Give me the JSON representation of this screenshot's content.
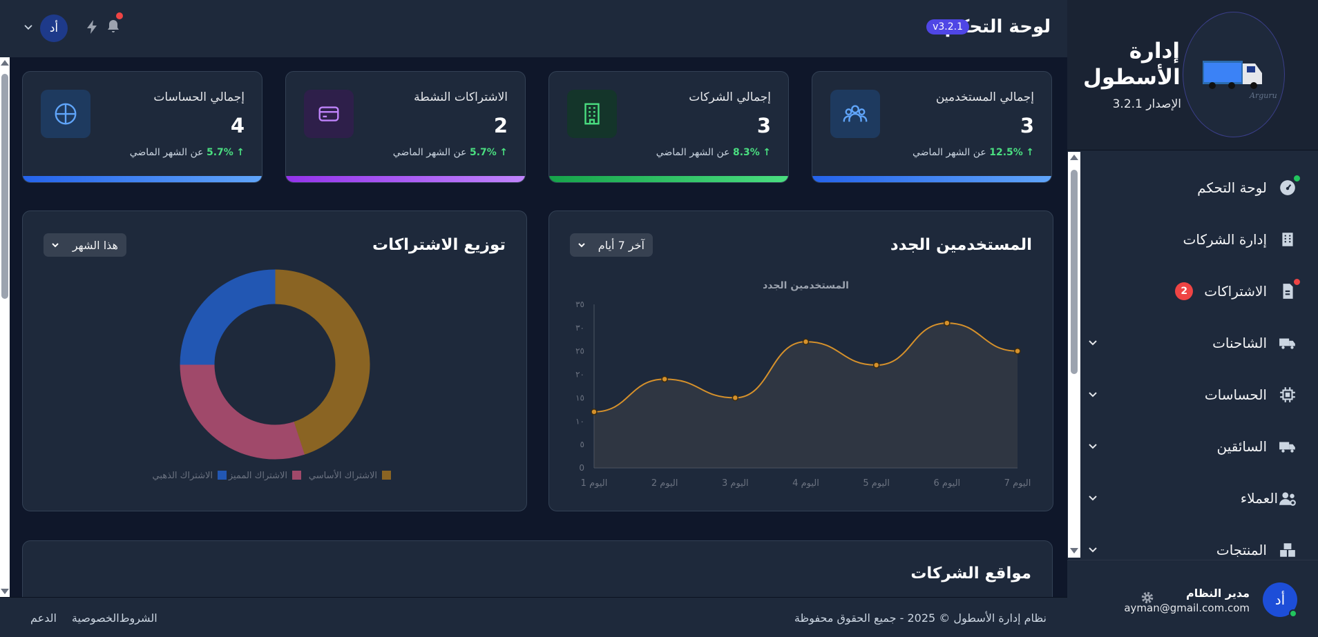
{
  "sidebar": {
    "brand_title": "إدارة الأسطول",
    "brand_version": "الإصدار 3.2.1",
    "logo_text": "Arguru",
    "items": [
      {
        "label": "لوحة التحكم",
        "icon": "gauge-icon"
      },
      {
        "label": "إدارة الشركات",
        "icon": "building-icon"
      },
      {
        "label": "الاشتراكات",
        "icon": "document-icon",
        "badge": "2"
      },
      {
        "label": "الشاحنات",
        "icon": "truck-icon"
      },
      {
        "label": "الحساسات",
        "icon": "chip-icon"
      },
      {
        "label": "السائقين",
        "icon": "truck-icon"
      },
      {
        "label": "العملاء",
        "icon": "users-icon"
      },
      {
        "label": "المنتجات",
        "icon": "boxes-icon"
      }
    ],
    "user": {
      "avatar": "أد",
      "name": "مدير النظام",
      "email": "ayman@gmail.com.com"
    }
  },
  "header": {
    "title": "لوحة التحكم",
    "version_badge": "v3.2.1",
    "avatar": "أد"
  },
  "stats": [
    {
      "label": "إجمالي المستخدمين",
      "value": "3",
      "trend": "12.5%",
      "trend_arrow": "↑",
      "trend_text": "عن الشهر الماضي",
      "color": "#3b82f6",
      "icon": "users-icon"
    },
    {
      "label": "إجمالي الشركات",
      "value": "3",
      "trend": "8.3%",
      "trend_arrow": "↑",
      "trend_text": "عن الشهر الماضي",
      "color": "#22c55e",
      "icon": "building-icon"
    },
    {
      "label": "الاشتراكات النشطة",
      "value": "2",
      "trend": "5.7%",
      "trend_arrow": "↑",
      "trend_text": "عن الشهر الماضي",
      "color": "#a855f7",
      "icon": "credit-card-icon"
    },
    {
      "label": "إجمالي الحساسات",
      "value": "4",
      "trend": "5.7%",
      "trend_arrow": "↑",
      "trend_text": "عن الشهر الماضي",
      "color": "#3b82f6",
      "icon": "crosshair-icon"
    }
  ],
  "new_users_card": {
    "title": "المستخدمين الجدد",
    "select": "آخر 7 أيام"
  },
  "subs_card": {
    "title": "توزيع الاشتراكات",
    "select": "هذا الشهر"
  },
  "locations_card": {
    "title": "مواقع الشركات"
  },
  "footer": {
    "copyright": "نظام إدارة الأسطول © 2025 - جميع الحقوق محفوظة",
    "links": [
      "الشروط",
      "الخصوصية",
      "الدعم"
    ]
  },
  "chart_data": [
    {
      "type": "area",
      "title": "المستخدمين الجدد",
      "categories": [
        "اليوم 1",
        "اليوم 2",
        "اليوم 3",
        "اليوم 4",
        "اليوم 5",
        "اليوم 6",
        "اليوم 7"
      ],
      "values": [
        12,
        19,
        15,
        27,
        22,
        31,
        25
      ],
      "ylim": [
        0,
        35
      ],
      "yticks": [
        "0",
        "٥",
        "١٠",
        "١٥",
        "٢٠",
        "٢٥",
        "٣٠",
        "٣٥"
      ],
      "color": "#d6912b"
    },
    {
      "type": "pie",
      "donut": true,
      "labels": [
        "الاشتراك الأساسي",
        "الاشتراك المميز",
        "الاشتراك الذهبي"
      ],
      "values": [
        45,
        30,
        25
      ],
      "colors": [
        "#8a6423",
        "#a0496a",
        "#2257b3"
      ]
    }
  ]
}
